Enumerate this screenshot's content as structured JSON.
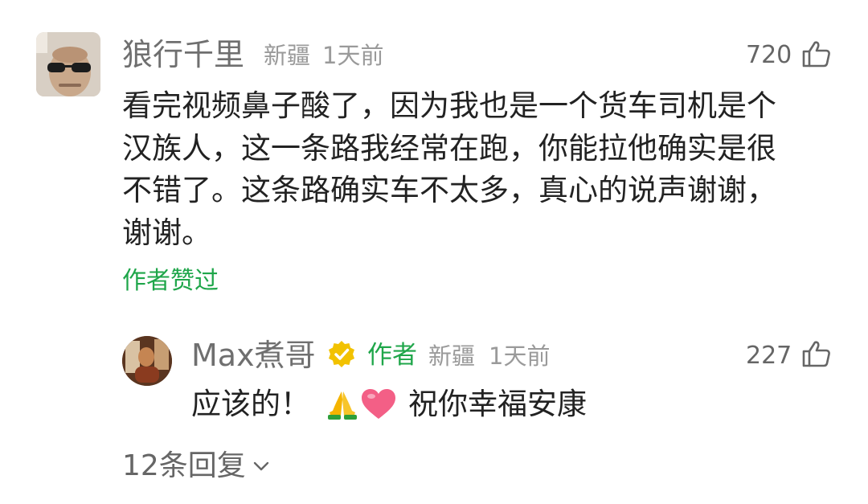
{
  "comment": {
    "username": "狼行千里",
    "location": "新疆",
    "time": "1天前",
    "likes": "720",
    "content_lines": [
      "看完视频鼻子酸了，因为我也是一个货车司机是个",
      "汉族人，这一条路我经常在跑，你能拉他确实是很",
      "不错了。这条路确实车不太多，真心的说声谢谢，",
      "谢谢。"
    ],
    "author_liked": "作者赞过"
  },
  "reply": {
    "username": "Max煮哥",
    "author_tag": "作者",
    "location": "新疆",
    "time": "1天前",
    "likes": "227",
    "content_prefix": "应该的！",
    "content_suffix": "祝你幸福安康"
  },
  "replies_link": "12条回复",
  "colors": {
    "accent_green": "#1fa64a",
    "verified_badge": "#f2c200"
  },
  "icons": [
    "thumbs-up-icon",
    "verified-badge-icon",
    "chevron-down-icon",
    "pray-emoji-icon",
    "heart-emoji-icon"
  ]
}
